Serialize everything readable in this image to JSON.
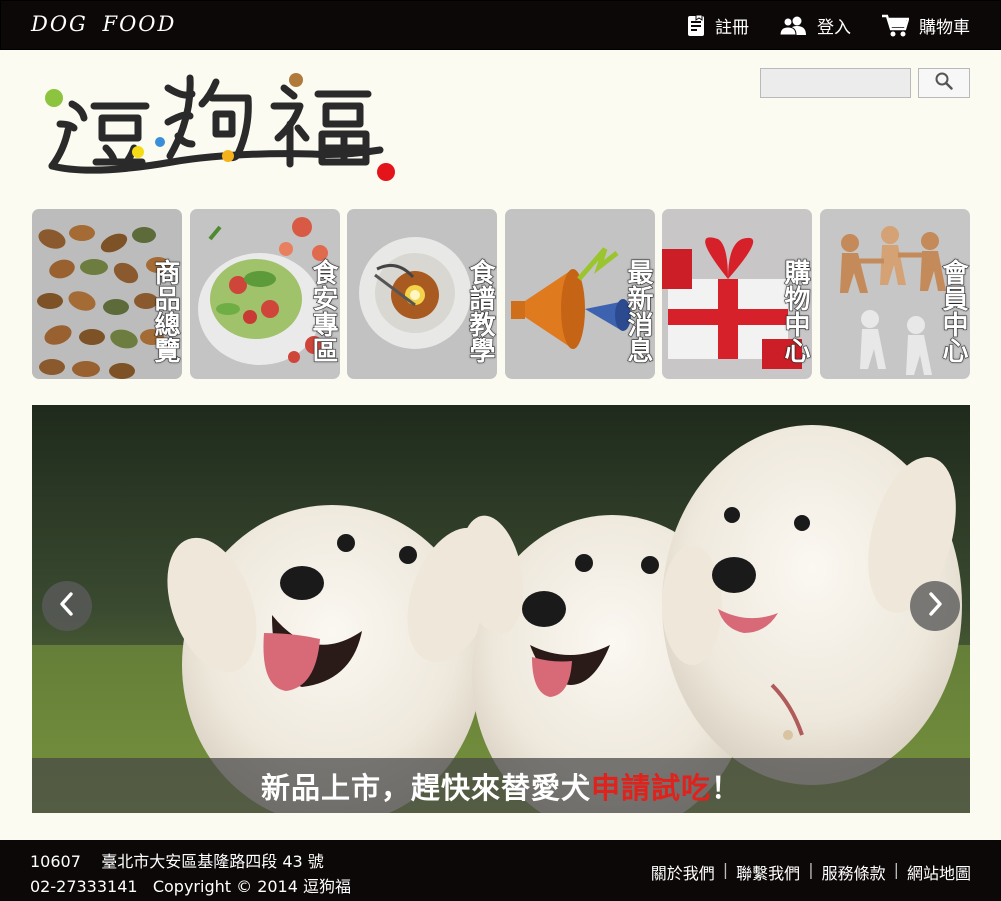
{
  "header": {
    "brand": "DOG FOOD",
    "nav": [
      {
        "label": "註冊",
        "icon": "register-icon"
      },
      {
        "label": "登入",
        "icon": "users-icon"
      },
      {
        "label": "購物車",
        "icon": "cart-icon"
      }
    ]
  },
  "logo": {
    "text": "逗狗福"
  },
  "search": {
    "placeholder": "",
    "value": ""
  },
  "categories": [
    {
      "label": "商品總覽"
    },
    {
      "label": "食安專區"
    },
    {
      "label": "食譜教學"
    },
    {
      "label": "最新消息"
    },
    {
      "label": "購物中心"
    },
    {
      "label": "會員中心"
    }
  ],
  "banner": {
    "caption_pre": "新品上市，趕快來替愛犬",
    "caption_highlight": "申請試吃",
    "caption_post": "！",
    "highlight_color": "#e0211c"
  },
  "footer": {
    "postcode": "10607",
    "address": "臺北市大安區基隆路四段 43 號",
    "phone": "02-27333141",
    "copyright": "Copyright © 2014 逗狗福",
    "links": [
      "關於我們",
      "聯繫我們",
      "服務條款",
      "網站地圖"
    ]
  }
}
